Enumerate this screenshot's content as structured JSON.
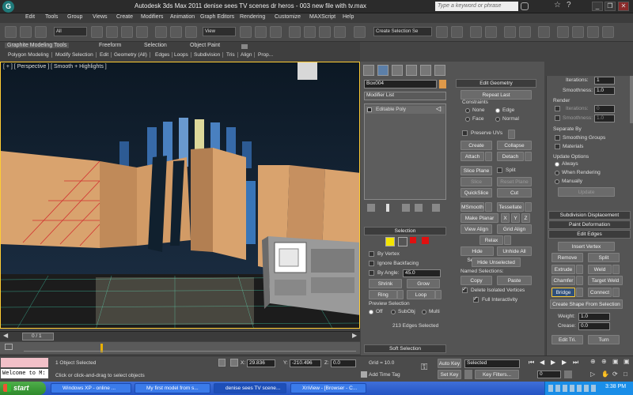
{
  "app": {
    "title": "Autodesk 3ds Max  2011     denise sees TV scenes dr heros - 003  new file with tv.max",
    "search_placeholder": "Type a keyword or phrase",
    "logo": "G"
  },
  "menu": [
    "Edit",
    "Tools",
    "Group",
    "Views",
    "Create",
    "Modifiers",
    "Animation",
    "Graph Editors",
    "Rendering",
    "Customize",
    "MAXScript",
    "Help"
  ],
  "toolbar": {
    "selection_filter": "All",
    "ref_coord": "View",
    "named_selection": "Create Selection Se"
  },
  "ribbon": {
    "tabs": [
      "Graphite Modeling Tools",
      "Freeform",
      "Selection",
      "Object Paint"
    ],
    "subtabs": [
      "Polygon Modeling",
      "Modify Selection",
      "Edit",
      "Geometry (All)",
      "Edges",
      "Loops",
      "Subdivision",
      "Tris",
      "Align",
      "Prop..."
    ]
  },
  "viewport": {
    "label": "[ + ] [ Perspective ] [ Smooth + Highlights ]"
  },
  "modify": {
    "object_name": "Box004",
    "modifier_list": "Modifier List",
    "stack_item": "Editable Poly",
    "selection": {
      "title": "Selection",
      "by_vertex": "By Vertex",
      "ignore_backfacing": "Ignore Backfacing",
      "by_angle": "By Angle:",
      "angle_value": "45.0",
      "shrink": "Shrink",
      "grow": "Grow",
      "ring": "Ring",
      "loop": "Loop",
      "preview_title": "Preview Selection",
      "preview_off": "Off",
      "preview_subobj": "SubObj",
      "preview_multi": "Multi",
      "status": "213 Edges Selected"
    },
    "soft_selection": "Soft Selection"
  },
  "edit_geometry": {
    "title": "Edit Geometry",
    "repeat_last": "Repeat Last",
    "constraints": "Constraints",
    "c_none": "None",
    "c_edge": "Edge",
    "c_face": "Face",
    "c_normal": "Normal",
    "preserve_uvs": "Preserve UVs",
    "create": "Create",
    "collapse": "Collapse",
    "attach": "Attach",
    "detach": "Detach",
    "slice_plane": "Slice Plane",
    "split": "Split",
    "slice": "Slice",
    "reset_plane": "Reset Plane",
    "quickslice": "QuickSlice",
    "cut": "Cut",
    "msmooth": "MSmooth",
    "tessellate": "Tessellate",
    "make_planar": "Make Planar",
    "x": "X",
    "y": "Y",
    "z": "Z",
    "view_align": "View Align",
    "grid_align": "Grid Align",
    "relax": "Relax",
    "hide_selected": "Hide Selected",
    "unhide_all": "Unhide All",
    "hide_unselected": "Hide Unselected",
    "named_selections": "Named Selections:",
    "copy": "Copy",
    "paste": "Paste",
    "delete_isolated": "Delete Isolated Vertices",
    "full_interactivity": "Full Interactivity"
  },
  "right": {
    "iterations": "Iterations:",
    "iterations_val": "1",
    "smoothness": "Smoothness:",
    "smoothness_val": "1.0",
    "render": "Render",
    "r_iterations_val": "0",
    "r_smoothness_val": "1.0",
    "separate_by": "Separate By",
    "smoothing_groups": "Smoothing Groups",
    "materials": "Materials",
    "update_options": "Update Options",
    "always": "Always",
    "when_rendering": "When Rendering",
    "manually": "Manually",
    "update": "Update",
    "subdivision_displacement": "Subdivision Displacement",
    "paint_deformation": "Paint Deformation",
    "edit_edges": "Edit Edges",
    "insert_vertex": "Insert Vertex",
    "remove": "Remove",
    "split": "Split",
    "extrude": "Extrude",
    "weld": "Weld",
    "chamfer": "Chamfer",
    "target_weld": "Target Weld",
    "bridge": "Bridge",
    "connect": "Connect",
    "create_shape": "Create Shape From Selection",
    "weight": "Weight:",
    "weight_val": "1.0",
    "crease": "Crease:",
    "crease_val": "0.0",
    "edit_tri": "Edit Tri.",
    "turn": "Turn"
  },
  "timeline": {
    "frame": "0 / 1"
  },
  "status": {
    "welcome": "Welcome to M:",
    "objects_selected": "1 Object Selected",
    "prompt": "Click or click-and-drag to select objects",
    "x": "29.836",
    "y": "-210.496",
    "z": "0.0",
    "grid": "Grid = 10.0",
    "add_time_tag": "Add Time Tag",
    "auto_key": "Auto Key",
    "set_key": "Set Key",
    "key_mode": "Selected",
    "key_filters": "Key Filters...",
    "frame_value": "0"
  },
  "taskbar": {
    "start": "start",
    "tasks": [
      "Windows XP - online ...",
      "My first model from s...",
      "denise sees TV scene...",
      "XnView - [Browser - C..."
    ],
    "clock": "3:38 PM"
  }
}
